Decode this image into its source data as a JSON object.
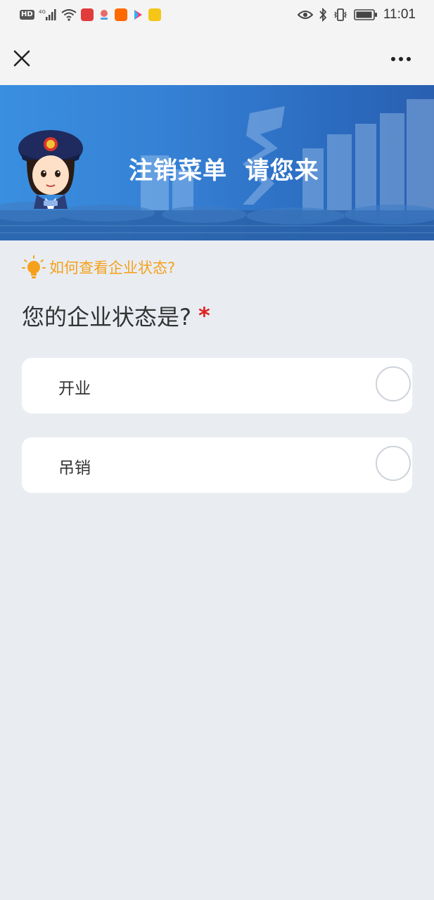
{
  "status_bar": {
    "network": "HD",
    "network_type": "4G",
    "time": "11:01",
    "icons": [
      "hd-icon",
      "signal-icon",
      "wifi-icon",
      "postal-app-icon",
      "location-app-icon",
      "taobao-app-icon",
      "video-app-icon",
      "mail-app-icon",
      "eye-icon",
      "bluetooth-icon",
      "vibrate-icon",
      "battery-icon"
    ]
  },
  "nav": {
    "close_icon": "close-icon",
    "more_icon": "more-icon"
  },
  "banner": {
    "title": "注销菜单  请您来",
    "colors": {
      "start": "#3a8fe0",
      "end": "#2a5fb0"
    }
  },
  "hint": {
    "text": "如何查看企业状态?",
    "icon": "lightbulb-icon",
    "color": "#f5a11c"
  },
  "question": {
    "text": "您的企业状态是?",
    "required_mark": "*"
  },
  "options": [
    {
      "label": "开业",
      "selected": false
    },
    {
      "label": "吊销",
      "selected": false
    }
  ]
}
